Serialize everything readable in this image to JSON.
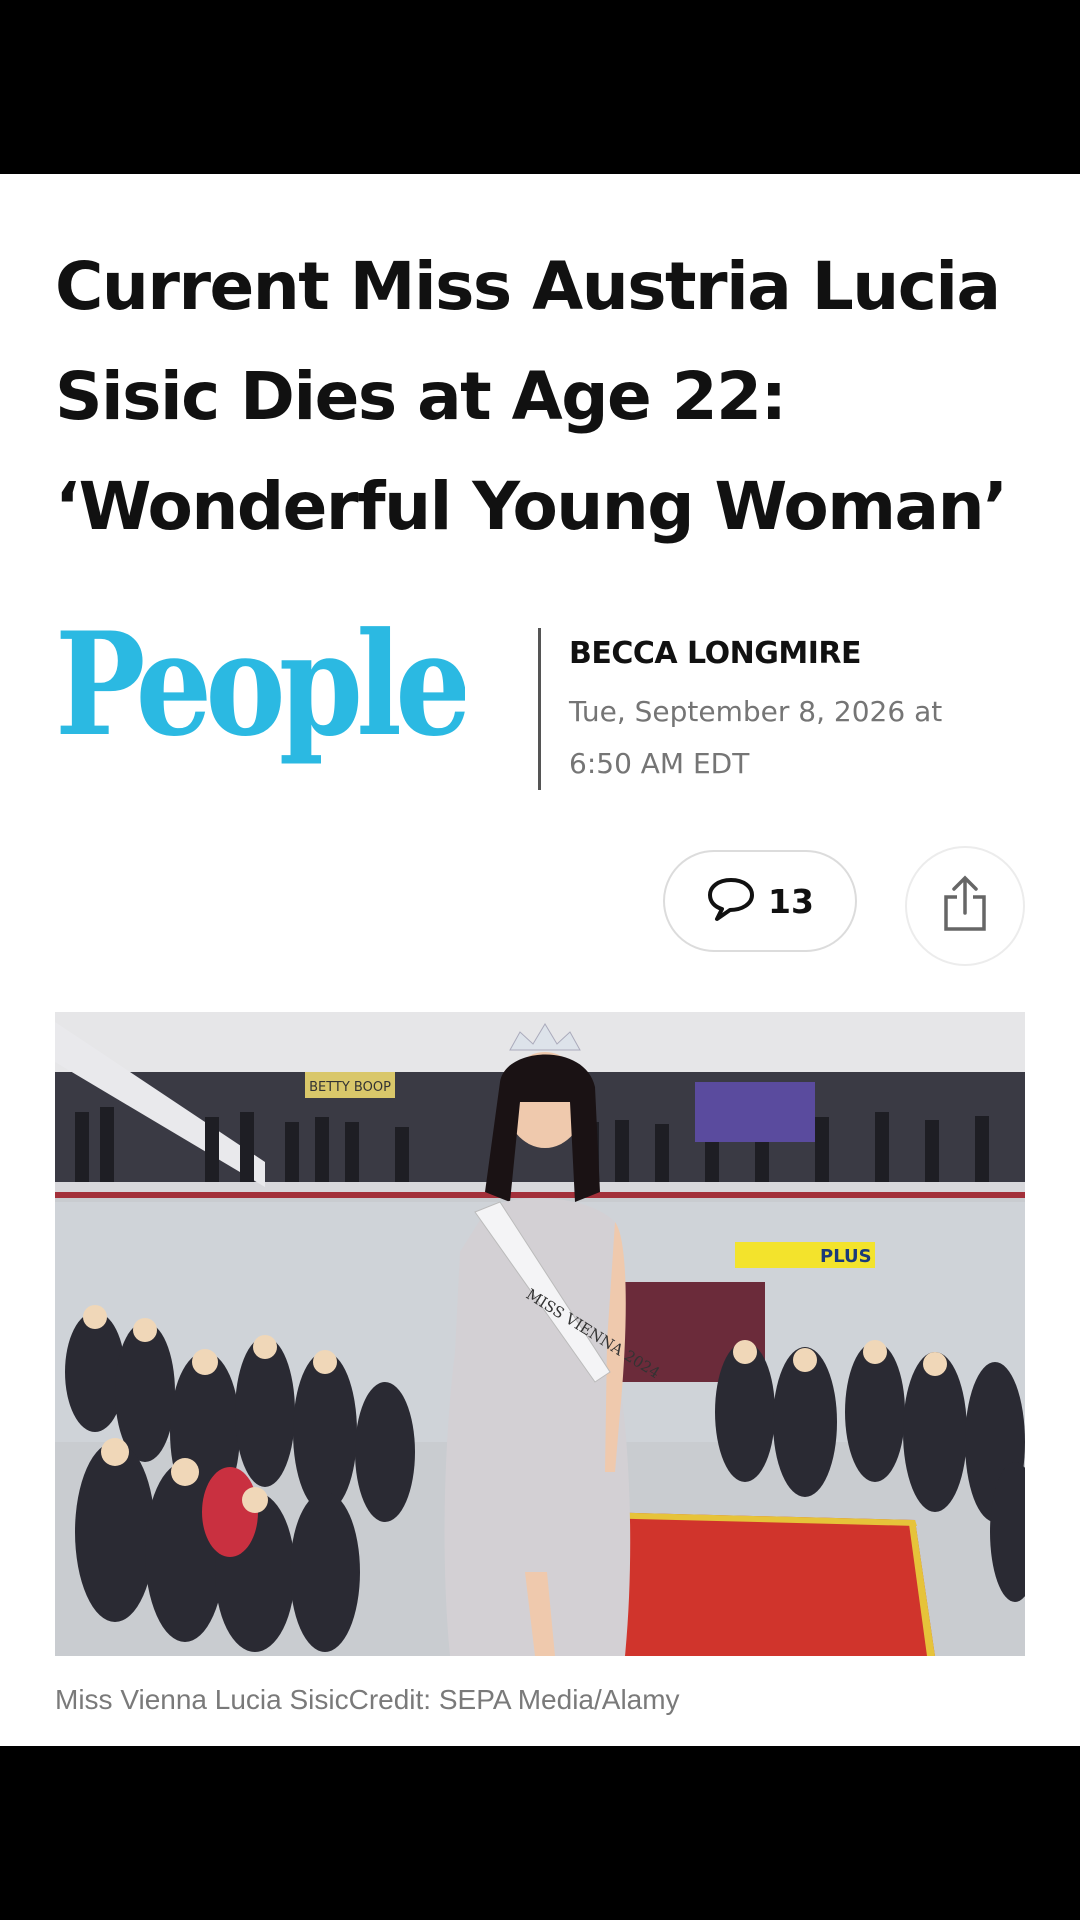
{
  "article": {
    "headline": "Current Miss Austria Lucia Sisic Dies at Age 22: ‘Wonderful Young Woman’",
    "publisher_logo_text": "People",
    "author": "BECCA LONGMIRE",
    "date": "Tue, September 8, 2026 at 6:50 AM EDT",
    "comments_count": "13",
    "photo": {
      "sash_line1": "MISS VIENNA 2024",
      "sign_text": "PLUS",
      "store_text": "BETTY BOOP"
    },
    "caption": "Miss Vienna Lucia SisicCredit: SEPA Media/Alamy"
  },
  "icons": {
    "comment": "speech-bubble-icon",
    "share": "share-icon"
  },
  "colors": {
    "logo_blue": "#2bb9e2",
    "headline": "#111111",
    "meta_gray": "#757575",
    "carpet_red": "#d0342c",
    "sign_yellow": "#f3e32c"
  }
}
